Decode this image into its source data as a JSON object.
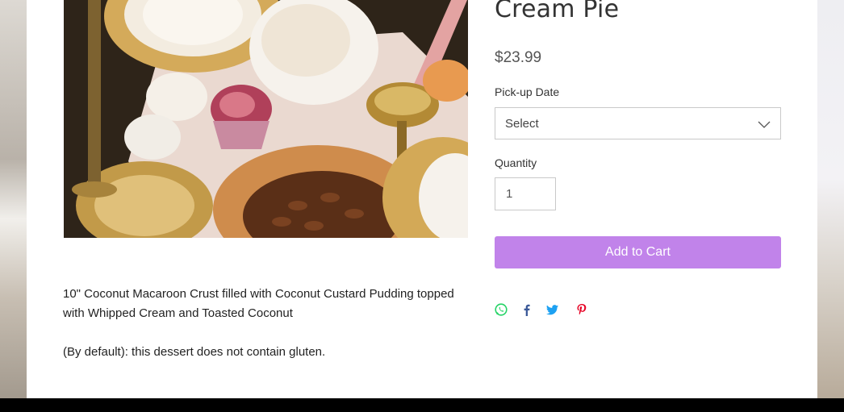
{
  "product": {
    "title": "Cream Pie",
    "price": "$23.99",
    "description": [
      "10\" Coconut Macaroon Crust filled with Coconut Custard Pudding topped with Whipped Cream and Toasted Coconut",
      "(By default): this dessert does not contain gluten."
    ]
  },
  "options": {
    "pickup_label": "Pick-up Date",
    "pickup_value": "Select",
    "quantity_label": "Quantity",
    "quantity_value": "1"
  },
  "actions": {
    "add_to_cart": "Add to Cart"
  },
  "share": [
    {
      "icon": "whatsapp-icon",
      "color": "#25D366"
    },
    {
      "icon": "facebook-icon",
      "color": "#3b5998"
    },
    {
      "icon": "twitter-icon",
      "color": "#1DA1F2"
    },
    {
      "icon": "pinterest-icon",
      "color": "#E60023"
    }
  ],
  "colors": {
    "accent": "#c183ea",
    "text": "#333333"
  }
}
